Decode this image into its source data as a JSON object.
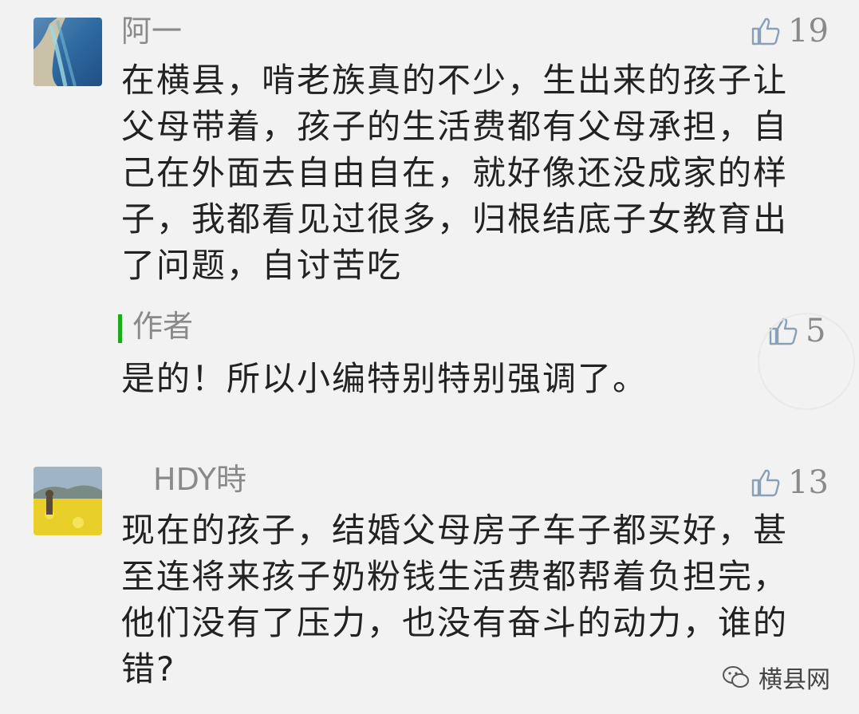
{
  "comments": [
    {
      "username": "阿一",
      "likes": "19",
      "text": "在横县，啃老族真的不少，生出来的孩子让父母带着，孩子的生活费都有父母承担，自己在外面去自由自在，就好像还没成家的样子，我都看见过很多，归根结底子女教育出了问题，自讨苦吃",
      "reply": {
        "label": "作者",
        "likes": "5",
        "text": "是的！所以小编特别特别强调了。"
      }
    },
    {
      "username": "HDY時",
      "likes": "13",
      "text": "现在的孩子，结婚父母房子车子都买好，甚至连将来孩子奶粉钱生活费都帮着负担完，他们没有了压力，也没有奋斗的动力，谁的错?"
    }
  ],
  "footer": {
    "brand": "横县网"
  },
  "colors": {
    "reply_bar": "#1aad19",
    "meta_text": "#8a8a8a"
  }
}
